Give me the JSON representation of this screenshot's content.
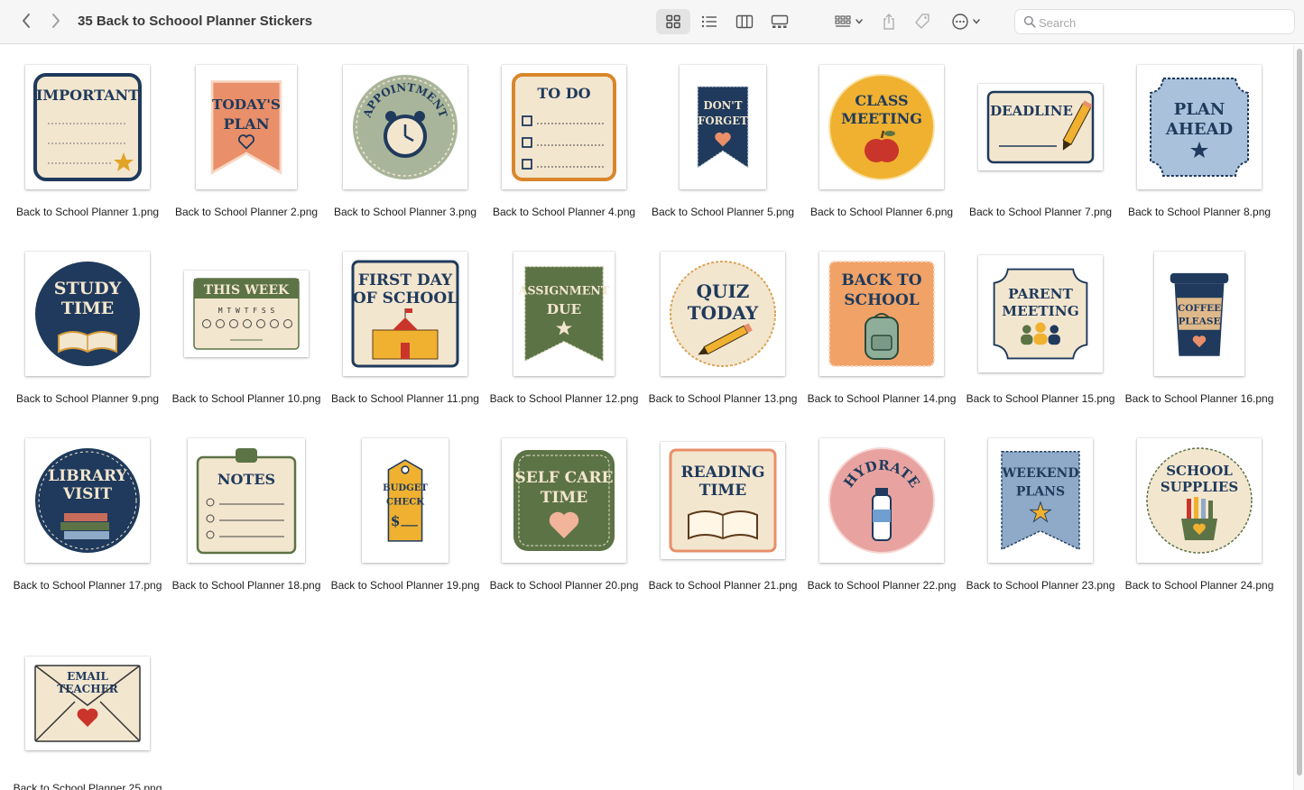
{
  "window": {
    "title": "35 Back to Schoool Planner Stickers"
  },
  "toolbar": {
    "back_icon": "chevron-left-icon",
    "forward_icon": "chevron-right-icon",
    "view_icons": "grid-view-icon",
    "view_list": "list-view-icon",
    "view_columns": "column-view-icon",
    "view_gallery": "gallery-view-icon",
    "group_menu": "group-by-icon",
    "share": "share-icon",
    "tag": "tag-icon",
    "more": "more-actions-icon",
    "selected_view": "icons"
  },
  "search": {
    "placeholder": "Search",
    "value": ""
  },
  "colors": {
    "toolbar_bg": "#f6f6f6",
    "selected_view_bg": "#e3e3e3",
    "navy": "#1f3a5c",
    "cream": "#f3e6cf",
    "orange": "#e98f6a",
    "mustard": "#efb12f",
    "sage": "#a9b59a",
    "olive": "#5c7346",
    "blue": "#8fa9c8",
    "pink": "#e8a3a0"
  },
  "files": [
    {
      "name": "Back to School Planner 1.png",
      "line1": "IMPORTANT",
      "line2": ""
    },
    {
      "name": "Back to School Planner 2.png",
      "line1": "TODAY'S",
      "line2": "PLAN"
    },
    {
      "name": "Back to School Planner 3.png",
      "line1": "APPOINTMENT",
      "line2": ""
    },
    {
      "name": "Back to School Planner 4.png",
      "line1": "TO DO",
      "line2": ""
    },
    {
      "name": "Back to School Planner 5.png",
      "line1": "DON'T",
      "line2": "FORGET"
    },
    {
      "name": "Back to School Planner 6.png",
      "line1": "CLASS",
      "line2": "MEETING"
    },
    {
      "name": "Back to School Planner 7.png",
      "line1": "DEADLINE",
      "line2": ""
    },
    {
      "name": "Back to School Planner 8.png",
      "line1": "PLAN",
      "line2": "AHEAD"
    },
    {
      "name": "Back to School Planner 9.png",
      "line1": "STUDY",
      "line2": "TIME"
    },
    {
      "name": "Back to School Planner 10.png",
      "line1": "THIS WEEK",
      "line2": "M T W T F S S"
    },
    {
      "name": "Back to School Planner 11.png",
      "line1": "FIRST DAY",
      "line2": "OF SCHOOL"
    },
    {
      "name": "Back to School Planner 12.png",
      "line1": "ASSIGNMENT",
      "line2": "DUE"
    },
    {
      "name": "Back to School Planner 13.png",
      "line1": "QUIZ",
      "line2": "TODAY"
    },
    {
      "name": "Back to School Planner 14.png",
      "line1": "BACK TO",
      "line2": "SCHOOL"
    },
    {
      "name": "Back to School Planner 15.png",
      "line1": "PARENT",
      "line2": "MEETING"
    },
    {
      "name": "Back to School Planner 16.png",
      "line1": "COFFEE",
      "line2": "PLEASE"
    },
    {
      "name": "Back to School Planner 17.png",
      "line1": "LIBRARY",
      "line2": "VISIT"
    },
    {
      "name": "Back to School Planner 18.png",
      "line1": "NOTES",
      "line2": ""
    },
    {
      "name": "Back to School Planner 19.png",
      "line1": "BUDGET",
      "line2": "CHECK"
    },
    {
      "name": "Back to School Planner 20.png",
      "line1": "SELF CARE",
      "line2": "TIME"
    },
    {
      "name": "Back to School Planner 21.png",
      "line1": "READING",
      "line2": "TIME"
    },
    {
      "name": "Back to School Planner 22.png",
      "line1": "HYDRATE",
      "line2": ""
    },
    {
      "name": "Back to School Planner 23.png",
      "line1": "WEEKEND",
      "line2": "PLANS"
    },
    {
      "name": "Back to School Planner 24.png",
      "line1": "SCHOOL",
      "line2": "SUPPLIES"
    },
    {
      "name": "Back to School Planner 25.png",
      "line1": "EMAIL",
      "line2": "TEACHER"
    }
  ]
}
